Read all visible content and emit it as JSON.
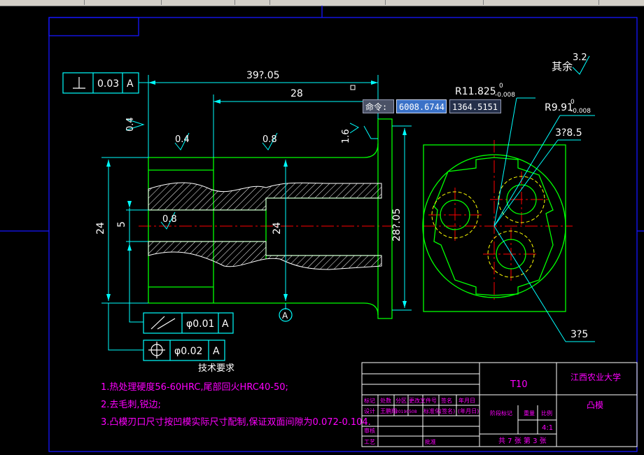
{
  "colors": {
    "background": "#000000",
    "border": "#1515ff",
    "outline": "#00ff00",
    "dimension": "#00ffff",
    "centerline": "#ff0000",
    "note": "#ff00ff",
    "hatch": "#ffffff",
    "hidden": "#ffff00",
    "title_text": "#ff00ff"
  },
  "command_input": {
    "label": "命令:",
    "x_value": "6008.6744",
    "y_value": "1364.5151"
  },
  "dimensions": {
    "overall_length": "39?.05",
    "step_length": "28",
    "diameter_left": "24",
    "diameter_inner": "5",
    "diameter_bore": "24",
    "diameter_flange": "28?.05",
    "radius_1": "R11.825",
    "radius_1_tol_upper": "0",
    "radius_1_tol_lower": "-0.008",
    "radius_2": "R9.91",
    "radius_2_tol_upper": "0",
    "radius_2_tol_lower": "-0.008",
    "circle_top": "3?8.5",
    "circle_bottom": "3?5"
  },
  "roughness": {
    "left_face": "0.4",
    "top_a": "0.4",
    "top_b": "0.8",
    "bore": "0.8",
    "flange_face": "1.6",
    "other": "其余",
    "other_value": "3.2"
  },
  "tolerance_frames": {
    "perpendicularity": {
      "value": "0.03",
      "datum": "A"
    },
    "runout": {
      "value": "φ0.01",
      "datum": "A"
    },
    "position": {
      "value": "φ0.02",
      "datum": "A"
    }
  },
  "datum_symbol": "A",
  "notes": {
    "heading": "技术要求",
    "items": [
      "1.热处理硬度56-60HRC,尾部回火HRC40-50;",
      "2.去毛刺,锐边;",
      "3.凸模刃口尺寸按凹模实际尺寸配制,保证双面间隙为0.072-0.104."
    ]
  },
  "title_block": {
    "drawing_code": "T10",
    "school": "江西农业大学",
    "part_name": "凸模",
    "scale": "4:1",
    "sheet_info": "共 7 张 第 3 张",
    "labels": {
      "mark": "标记",
      "count": "处数",
      "zone": "分区",
      "change_doc": "更改文件号",
      "signature": "签名",
      "date": "年月日",
      "design": "设计",
      "designer": "王鹏翔",
      "design_date": "20190508",
      "standard": "标准化",
      "signature_2": "(签名)",
      "date_2": "(年月日)",
      "stage_mark": "阶段标记",
      "weight": "重量",
      "scale_label": "比例",
      "review": "审核",
      "process": "工艺",
      "approve": "批准"
    }
  }
}
